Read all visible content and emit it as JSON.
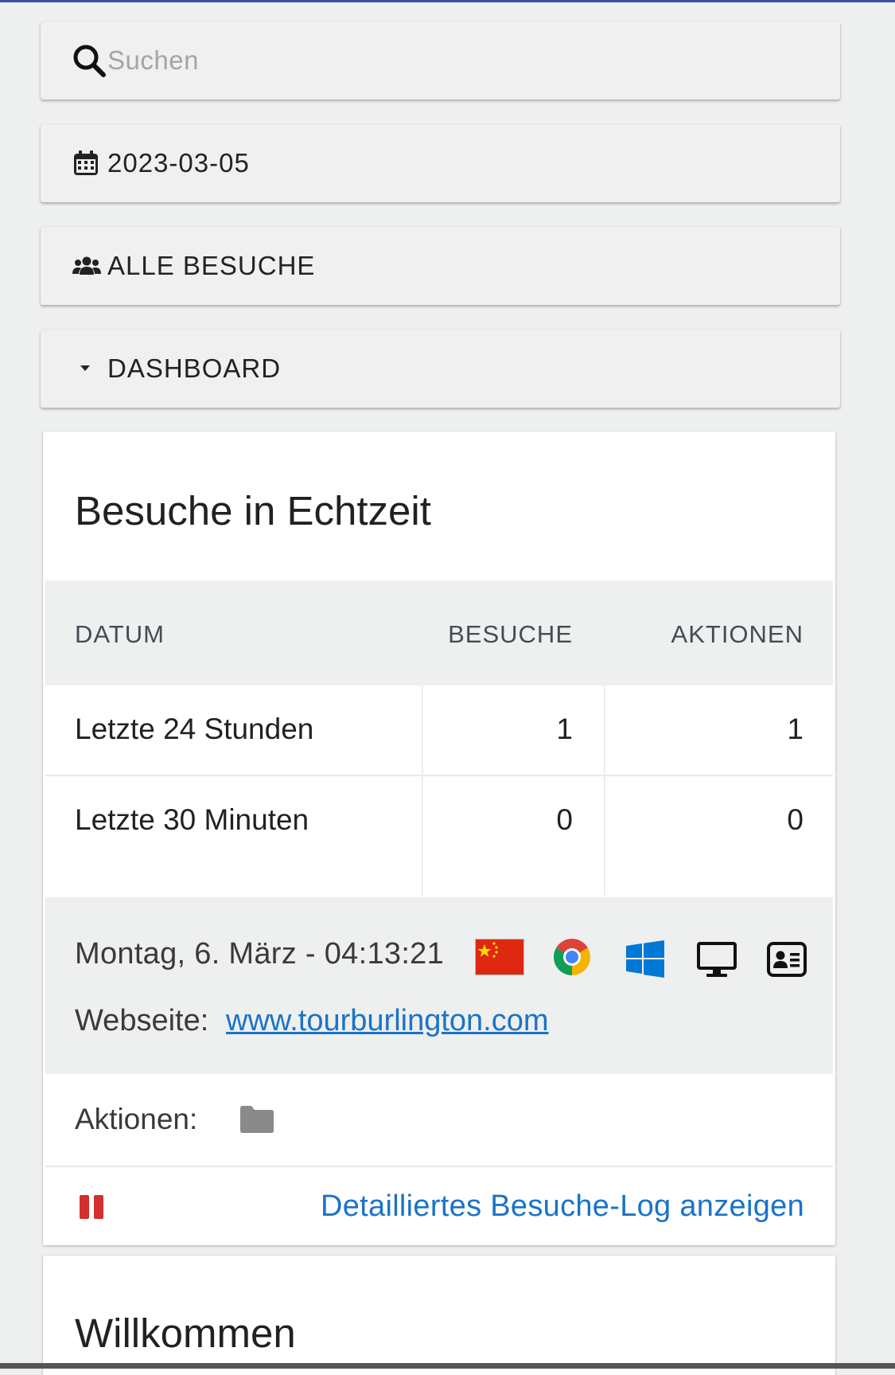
{
  "search": {
    "placeholder": "Suchen",
    "icon": "search-icon"
  },
  "date_picker": {
    "value": "2023-03-05",
    "icon": "calendar-icon"
  },
  "segment": {
    "label": "ALLE BESUCHE",
    "icon": "users-icon"
  },
  "dashboard_menu": {
    "label": "DASHBOARD",
    "icon": "caret-down-icon"
  },
  "realtime_widget": {
    "title": "Besuche in Echtzeit",
    "columns": [
      "DATUM",
      "BESUCHE",
      "AKTIONEN"
    ],
    "rows": [
      {
        "label": "Letzte 24 Stunden",
        "visits": "1",
        "actions": "1"
      },
      {
        "label": "Letzte 30 Minuten",
        "visits": "0",
        "actions": "0"
      }
    ],
    "last_visit": {
      "datetime": "Montag, 6. März - 04:13:21",
      "country_flag": "china-flag-icon",
      "browser": "chrome-icon",
      "os": "windows-icon",
      "device": "desktop-icon",
      "visitor_profile": "visitor-profile-icon",
      "website_label": "Webseite:",
      "website_url": "www.tourburlington.com"
    },
    "actions_label": "Aktionen:",
    "actions_icon": "folder-icon",
    "pause_icon": "pause-icon",
    "log_link": "Detailliertes Besuche-Log anzeigen"
  },
  "welcome_widget": {
    "title": "Willkommen"
  },
  "colors": {
    "accent_top": "#3f4fae",
    "link": "#1a73c8",
    "pause": "#d32f2f",
    "background": "#eeefef"
  }
}
